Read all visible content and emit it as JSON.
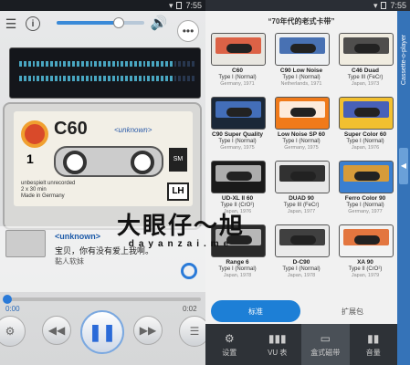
{
  "status_bar": {
    "time": "7:55"
  },
  "player": {
    "cassette": {
      "brand": "C60",
      "label_text": "<unknown>",
      "side": "1",
      "small1": "unbespielt",
      "small2": "unrecorded",
      "small3": "2 x 30 min",
      "small4": "Made in Germany",
      "badge": "LH",
      "sm": "SM"
    },
    "track": {
      "title": "<unknown>",
      "line1": "宝贝，你有没有爱上我啊。",
      "line2": "黏人软妹"
    },
    "time_start": "0:00",
    "time_end": "0:02"
  },
  "catalog": {
    "title": "70年代的老式卡带",
    "items": [
      {
        "name": "C60",
        "type": "Type I (Normal)",
        "origin": "Germany, 1971",
        "color": "#e8e6e0",
        "accent": "#d94a2a"
      },
      {
        "name": "C90 Low Noise",
        "type": "Type I (Normal)",
        "origin": "Netherlands, 1971",
        "color": "#eef0f2",
        "accent": "#2a5aa8"
      },
      {
        "name": "C46 Duad",
        "type": "Type III (FeCr)",
        "origin": "Japan, 1973",
        "color": "#f0ece0",
        "accent": "#333"
      },
      {
        "name": "C90 Super Quality",
        "type": "Type I (Normal)",
        "origin": "Germany, 1975",
        "color": "#1b2838",
        "accent": "#4a7ad0"
      },
      {
        "name": "Low Noise SP 60",
        "type": "Type I (Normal)",
        "origin": "Germany, 1975",
        "color": "#f07a1a",
        "accent": "#fff"
      },
      {
        "name": "Super Color 60",
        "type": "Type I (Normal)",
        "origin": "Japan, 1976",
        "color": "#f2c030",
        "accent": "#2a4fd0"
      },
      {
        "name": "UD-XL II 60",
        "type": "Type II (CrO²)",
        "origin": "Japan, 1976",
        "color": "#1a1a1a",
        "accent": "#c8c8c8"
      },
      {
        "name": "DUAD 90",
        "type": "Type III (FeCr)",
        "origin": "Japan, 1977",
        "color": "#e8e8e8",
        "accent": "#111"
      },
      {
        "name": "Ferro Color 90",
        "type": "Type I (Normal)",
        "origin": "Germany, 1977",
        "color": "#3a7fd0",
        "accent": "#f2a020"
      },
      {
        "name": "Range 6",
        "type": "Type I (Normal)",
        "origin": "Japan, 1978",
        "color": "#2a2a2a",
        "accent": "#d0d0d0"
      },
      {
        "name": "D-C90",
        "type": "Type I (Normal)",
        "origin": "Japan, 1978",
        "color": "#eaeaea",
        "accent": "#222"
      },
      {
        "name": "XA 90",
        "type": "Type II (CrO²)",
        "origin": "Japan, 1979",
        "color": "#f2f2f2",
        "accent": "#e06020"
      }
    ],
    "tab_standard": "标准",
    "tab_extension": "扩展包"
  },
  "bottom_nav": [
    {
      "label": "设置",
      "icon": "sliders-icon"
    },
    {
      "label": "VU 表",
      "icon": "vu-icon"
    },
    {
      "label": "盒式磁带",
      "icon": "cassette-icon"
    },
    {
      "label": "音量",
      "icon": "volume-icon"
    }
  ],
  "side_panel": {
    "label": "Cassette-o-player"
  },
  "watermark": {
    "main": "大眼仔～旭",
    "sub": "dayanzai.me"
  }
}
